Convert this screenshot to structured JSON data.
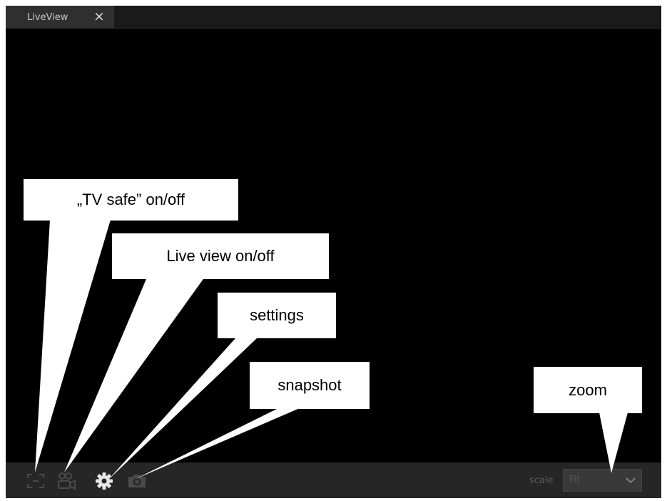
{
  "window": {
    "tab_label": "LiveView",
    "tab_close": "×"
  },
  "toolbar": {
    "buttons": [
      {
        "icon": "tv-safe-icon",
        "state": "disabled"
      },
      {
        "icon": "live-view-camera-icon",
        "state": "disabled"
      },
      {
        "icon": "gear-icon",
        "state": "enabled"
      },
      {
        "icon": "camera-snapshot-icon",
        "state": "disabled"
      }
    ],
    "scale_label": "scale",
    "scale_value": "Fit",
    "scale_icon": "chevron-down-icon"
  },
  "callouts": {
    "tv_safe": "„TV safe” on/off",
    "live_view": "Live view on/off",
    "settings": "settings",
    "snapshot": "snapshot",
    "zoom": "zoom"
  },
  "colors": {
    "background": "#000000",
    "tab_bar": "#1a1a1a",
    "active_tab": "#2f2f2f",
    "toolbar": "#262626",
    "icon_disabled": "#4a4a4a",
    "icon_enabled": "#e6e6e6",
    "callout": "#ffffff"
  }
}
